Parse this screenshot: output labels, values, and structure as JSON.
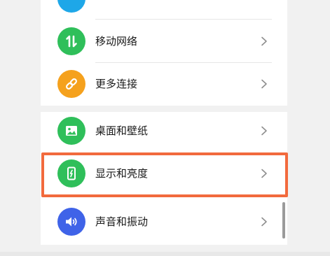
{
  "settings": {
    "items": [
      {
        "label": "移动网络",
        "icon": "mobile-data-icon",
        "icon_color": "#2fbf5a"
      },
      {
        "label": "更多连接",
        "icon": "link-icon",
        "icon_color": "#f5a11d"
      },
      {
        "label": "桌面和壁纸",
        "icon": "wallpaper-icon",
        "icon_color": "#2fbf5a"
      },
      {
        "label": "显示和亮度",
        "icon": "display-brightness-icon",
        "icon_color": "#2fbf5a"
      },
      {
        "label": "声音和振动",
        "icon": "sound-icon",
        "icon_color": "#3f63e8"
      }
    ],
    "partial_item_icon_color": "#1ea7e8",
    "highlight_color": "#f26a3d"
  }
}
